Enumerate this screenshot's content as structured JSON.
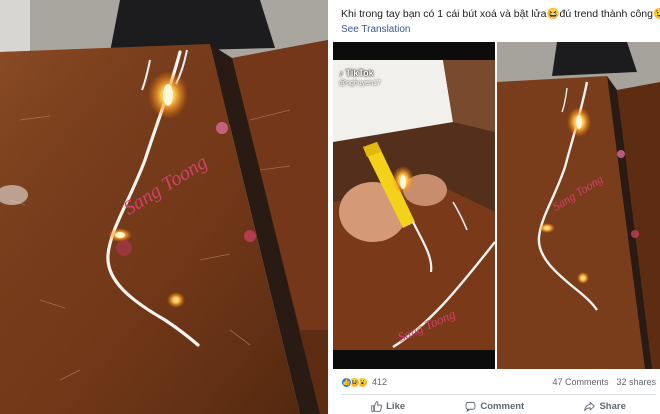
{
  "post": {
    "caption": "Khi trong tay bạn có 1 cái bút xoá và bật lửa😆đú trend thành công😉",
    "see_translation": "See Translation",
    "tiktok": {
      "brand": "TikTok",
      "username": "@nghuyen17"
    },
    "reactions": {
      "icons": [
        "like-icon",
        "haha-icon",
        "wow-icon"
      ],
      "count": "412"
    },
    "comments": "47 Comments",
    "shares": "32 shares",
    "actions": {
      "like": "Like",
      "comment": "Comment",
      "share": "Share"
    }
  },
  "photo_text": {
    "desk_writing": "Sang Toong",
    "desk_writing_lower": "Sang Toong"
  },
  "colors": {
    "link": "#385898",
    "like_blue": "#1877f2",
    "text_secondary": "#606770",
    "flame": "#ffd36b"
  }
}
